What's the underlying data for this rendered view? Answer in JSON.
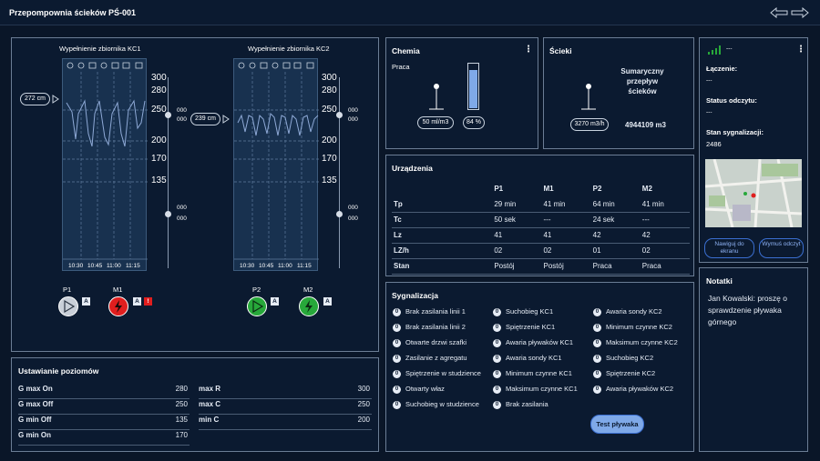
{
  "header": {
    "title": "Przepompownia ścieków PŚ-001"
  },
  "kc1": {
    "title": "Wypełnienie zbiornika KC1",
    "level": "272 cm",
    "ticks": [
      "300",
      "280",
      "250",
      "200",
      "170",
      "135"
    ],
    "times": [
      "10:30",
      "10:45",
      "11:00",
      "11:15"
    ],
    "slider_top": "000",
    "slider_top2": "000",
    "slider_bot": "000",
    "slider_bot2": "000"
  },
  "kc2": {
    "title": "Wypełnienie zbiornika KC2",
    "level": "239 cm",
    "ticks": [
      "300",
      "280",
      "250",
      "200",
      "170",
      "135"
    ],
    "times": [
      "10:30",
      "10:45",
      "11:00",
      "11:15"
    ],
    "slider_top": "000",
    "slider_top2": "000",
    "slider_bot": "000",
    "slider_bot2": "000"
  },
  "pumps": [
    {
      "name": "P1",
      "mode": "A",
      "color": "#c9cfd8"
    },
    {
      "name": "M1",
      "mode": "A",
      "alarm": "!",
      "color": "#e01e1e"
    },
    {
      "name": "P2",
      "mode": "A",
      "color": "#27a83a"
    },
    {
      "name": "M2",
      "mode": "A",
      "color": "#27a83a"
    }
  ],
  "chemia": {
    "title": "Chemia",
    "status": "Praca",
    "dose": "50 ml/m3",
    "fill": "84 %",
    "fill_pct": 84
  },
  "scieki": {
    "title": "Ścieki",
    "label": "Sumaryczny przepływ ścieków",
    "flow": "3270 m3/h",
    "total": "4944109 m3"
  },
  "status": {
    "signal": "---",
    "conn_label": "Łączenie:",
    "conn_val": "---",
    "read_label": "Status odczytu:",
    "read_val": "---",
    "sig_label": "Stan sygnalizacji:",
    "sig_val": "2486",
    "nav_btn": "Nawiguj do ekranu",
    "read_btn": "Wymuś odczyt"
  },
  "devices": {
    "title": "Urządzenia",
    "cols": [
      "",
      "P1",
      "M1",
      "P2",
      "M2"
    ],
    "rows": [
      [
        "Tp",
        "29 min",
        "41 min",
        "64 min",
        "41 min"
      ],
      [
        "Tc",
        "50 sek",
        "---",
        "24 sek",
        "---"
      ],
      [
        "Lz",
        "41",
        "41",
        "42",
        "42"
      ],
      [
        "LZ/h",
        "02",
        "02",
        "01",
        "02"
      ],
      [
        "Stan",
        "Postój",
        "Postój",
        "Praca",
        "Praca"
      ]
    ]
  },
  "signals": {
    "title": "Sygnalizacja",
    "col1": [
      "Brak zasilania linii 1",
      "Brak zasilania linii 2",
      "Otwarte drzwi szafki",
      "Zasilanie z agregatu",
      "Spiętrzenie w studzience",
      "Otwarty właz",
      "Suchobieg w studzience"
    ],
    "col2": [
      "Suchobieg KC1",
      "Spiętrzenie KC1",
      "Awaria pływaków KC1",
      "Awaria sondy KC1",
      "Minimum czynne KC1",
      "Maksimum czynne KC1",
      "Brak zasilania"
    ],
    "col3": [
      "Awaria sondy KC2",
      "Minimum czynne KC2",
      "Maksimum czynne KC2",
      "Suchobieg KC2",
      "Spiętrzenie KC2",
      "Awaria pływaków KC2"
    ],
    "dot": "0",
    "test_btn": "Test pływaka"
  },
  "notes": {
    "title": "Notatki",
    "text": "Jan Kowalski: proszę o sprawdzenie pływaka górnego"
  },
  "levels": {
    "title": "Ustawianie poziomów",
    "left": [
      [
        "G max On",
        "280"
      ],
      [
        "G max Off",
        "250"
      ],
      [
        "G min Off",
        "135"
      ],
      [
        "G min On",
        "170"
      ]
    ],
    "right": [
      [
        "max R",
        "300"
      ],
      [
        "max C",
        "250"
      ],
      [
        "min C",
        "200"
      ]
    ]
  }
}
